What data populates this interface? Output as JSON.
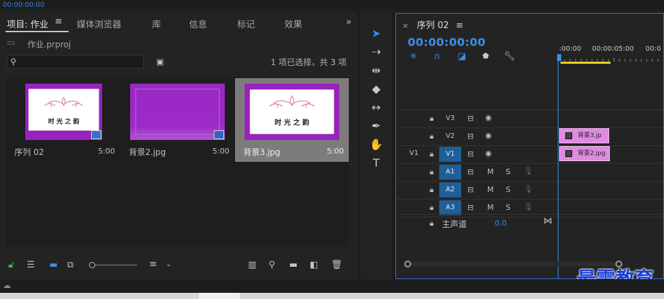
{
  "top": {
    "timecode": "00:00:00:00"
  },
  "project": {
    "tabs": [
      {
        "label": "项目: 作业"
      },
      {
        "label": "媒体浏览器"
      },
      {
        "label": "库"
      },
      {
        "label": "信息"
      },
      {
        "label": "标记"
      },
      {
        "label": "效果"
      }
    ],
    "menu_icon": "hamburger-menu-icon",
    "more_icon": "double-chevron-right-icon",
    "file_name": "作业.prproj",
    "search_placeholder": "",
    "selection_status": "1 项已选择，共 3 项",
    "items": [
      {
        "name": "序列 02",
        "duration": "5:00",
        "thumb_text": "时  光  之  韵",
        "type": "sequence"
      },
      {
        "name": "背景2.jpg",
        "duration": "5:00",
        "thumb_text": "",
        "type": "image"
      },
      {
        "name": "背景3.jpg",
        "duration": "5:00",
        "thumb_text": "时  光  之  韵",
        "type": "image",
        "selected": true
      }
    ]
  },
  "tools": [
    {
      "name": "selection-tool-icon",
      "glyph": "➤",
      "active": true
    },
    {
      "name": "track-select-tool-icon",
      "glyph": "⇢"
    },
    {
      "name": "ripple-edit-tool-icon",
      "glyph": "⇹"
    },
    {
      "name": "razor-tool-icon",
      "glyph": "◆"
    },
    {
      "name": "slip-tool-icon",
      "glyph": "↔"
    },
    {
      "name": "pen-tool-icon",
      "glyph": "✒"
    },
    {
      "name": "hand-tool-icon",
      "glyph": "✋"
    },
    {
      "name": "type-tool-icon",
      "glyph": "T"
    }
  ],
  "timeline": {
    "close_glyph": "×",
    "title": "序列 02",
    "menu_glyph": "≡",
    "timecode": "00:00:00:00",
    "ruler_labels": [
      ":00:00",
      "00:00:05:00",
      "00:0"
    ],
    "tracks": [
      {
        "source": "",
        "name": "V3",
        "kind": "video",
        "selected": false
      },
      {
        "source": "",
        "name": "V2",
        "kind": "video",
        "selected": false
      },
      {
        "source": "V1",
        "name": "V1",
        "kind": "video",
        "selected": true
      },
      {
        "source": "",
        "name": "A1",
        "kind": "audio",
        "selected": true
      },
      {
        "source": "",
        "name": "A2",
        "kind": "audio",
        "selected": true
      },
      {
        "source": "",
        "name": "A3",
        "kind": "audio",
        "selected": true
      }
    ],
    "mute_label": "M",
    "solo_label": "S",
    "master_label": "主声道",
    "master_value": "0.0",
    "clips": [
      {
        "label": "背景3.jp",
        "track": "V2"
      },
      {
        "label": "背景2.jpg",
        "track": "V1"
      }
    ]
  },
  "watermark": "最需教育",
  "colors": {
    "accent": "#3b8fe8",
    "clip": "#e18ae2",
    "thumb_purple": "#9a22c0",
    "track_selected": "#1f5f99"
  }
}
